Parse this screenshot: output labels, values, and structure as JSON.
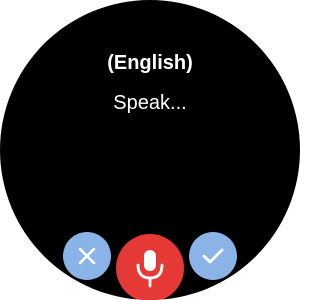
{
  "header": {
    "language": "(English)"
  },
  "main": {
    "prompt": "Speak..."
  },
  "controls": {
    "cancel_icon": "close-icon",
    "mic_icon": "microphone-icon",
    "confirm_icon": "check-icon"
  },
  "colors": {
    "background": "#000000",
    "text": "#ffffff",
    "secondary_button": "#8ab4e8",
    "secondary_icon": "#ffffff",
    "mic_button": "#e53935",
    "mic_icon": "#ffffff"
  }
}
